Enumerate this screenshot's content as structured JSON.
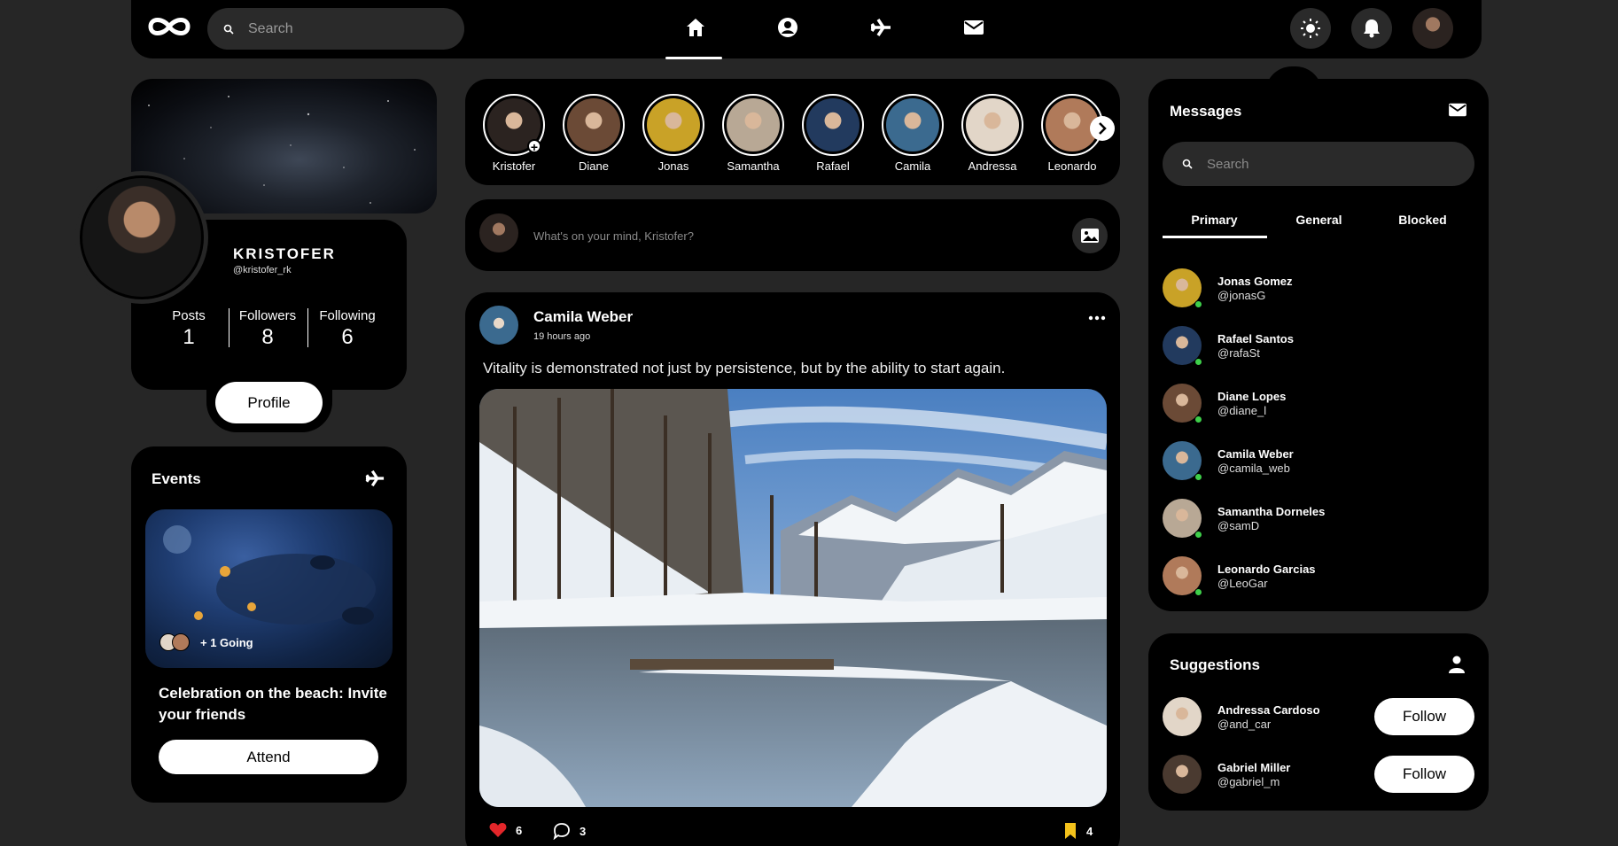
{
  "header": {
    "search_placeholder": "Search",
    "theme_tooltip": "light"
  },
  "profile": {
    "name": "KRISTOFER",
    "handle": "@kristofer_rk",
    "stats": [
      {
        "label": "Posts",
        "value": "1"
      },
      {
        "label": "Followers",
        "value": "8"
      },
      {
        "label": "Following",
        "value": "6"
      }
    ],
    "button": "Profile"
  },
  "events": {
    "title": "Events",
    "going": "+ 1 Going",
    "description": "Celebration on the beach: Invite your friends",
    "button": "Attend"
  },
  "stories": [
    {
      "name": "Kristofer",
      "color": "#2b2320"
    },
    {
      "name": "Diane",
      "color": "#6b4a36"
    },
    {
      "name": "Jonas",
      "color": "#c9a227"
    },
    {
      "name": "Samantha",
      "color": "#b8a895"
    },
    {
      "name": "Rafael",
      "color": "#223a5e"
    },
    {
      "name": "Camila",
      "color": "#3b6a8f"
    },
    {
      "name": "Andressa",
      "color": "#e2d6c8"
    },
    {
      "name": "Leonardo",
      "color": "#b07a5a"
    }
  ],
  "composer": {
    "placeholder": "What's on your mind, Kristofer?"
  },
  "post": {
    "author": "Camila Weber",
    "time": "19 hours ago",
    "text": "Vitality is demonstrated not just by persistence, but by the ability to start again.",
    "likes": "6",
    "comments": "3",
    "saves": "4"
  },
  "messages": {
    "title": "Messages",
    "search_placeholder": "Search",
    "tabs": [
      "Primary",
      "General",
      "Blocked"
    ],
    "contacts": [
      {
        "name": "Jonas Gomez",
        "handle": "@jonasG",
        "color": "#c9a227"
      },
      {
        "name": "Rafael Santos",
        "handle": "@rafaSt",
        "color": "#223a5e"
      },
      {
        "name": "Diane Lopes",
        "handle": "@diane_l",
        "color": "#6b4a36"
      },
      {
        "name": "Camila Weber",
        "handle": "@camila_web",
        "color": "#3b6a8f"
      },
      {
        "name": "Samantha Dorneles",
        "handle": "@samD",
        "color": "#b8a895"
      },
      {
        "name": "Leonardo Garcias",
        "handle": "@LeoGar",
        "color": "#b07a5a"
      }
    ]
  },
  "suggestions": {
    "title": "Suggestions",
    "items": [
      {
        "name": "Andressa Cardoso",
        "handle": "@and_car",
        "button": "Follow",
        "color": "#e2d6c8"
      },
      {
        "name": "Gabriel Miller",
        "handle": "@gabriel_m",
        "button": "Follow",
        "color": "#4a3a30"
      }
    ]
  }
}
